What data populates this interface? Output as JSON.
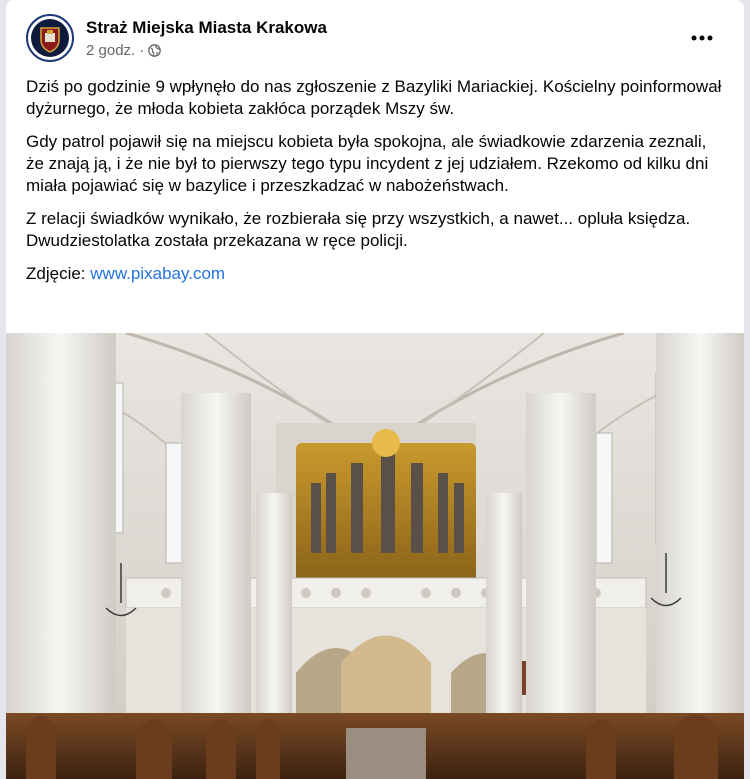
{
  "post": {
    "author": "Straż Miejska Miasta Krakowa",
    "time": "2 godz.",
    "separator": "·",
    "privacy_icon": "globe-icon",
    "more_icon": "more-options-icon",
    "paragraphs": [
      "Dziś po godzinie 9 wpłynęło do nas zgłoszenie z Bazyliki Mariackiej. Kościelny poinformował dyżurnego, że młoda kobieta zakłóca porządek Mszy św.",
      "Gdy patrol pojawił się na miejscu kobieta była spokojna, ale świadkowie zdarzenia zeznali, że znają ją, i że nie był to pierwszy tego typu incydent z jej udziałem. Rzekomo od kilku dni miała pojawiać się w bazylice i przeszkadzać w nabożeństwach.",
      "Z relacji świadków wynikało, że rozbierała się przy wszystkich, a nawet... opluła księdza. Dwudziestolatka została przekazana w ręce policji."
    ],
    "photo_credit_label": "Zdjęcie:",
    "photo_credit_link": "www.pixabay.com"
  },
  "colors": {
    "link": "#2374e1",
    "text": "#050505",
    "secondary": "#65676b"
  }
}
